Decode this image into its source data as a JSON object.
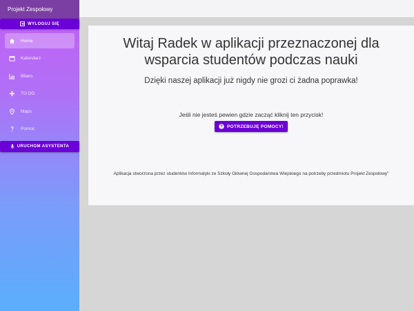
{
  "app": {
    "title": "Projekt Zespołowy"
  },
  "sidebar": {
    "logout_label": "WYLOGUJ SIĘ",
    "items": [
      {
        "label": "Home",
        "icon": "home-icon",
        "active": true
      },
      {
        "label": "Kalendarz",
        "icon": "calendar-icon",
        "active": false
      },
      {
        "label": "Bilans",
        "icon": "chart-icon",
        "active": false
      },
      {
        "label": "TO DO",
        "icon": "plus-icon",
        "active": false
      },
      {
        "label": "Maps",
        "icon": "map-pin-icon",
        "active": false
      },
      {
        "label": "Pomoc",
        "icon": "help-icon",
        "active": false
      }
    ],
    "assistant_label": "URUCHOM ASYSTENTA"
  },
  "main": {
    "welcome": "Witaj Radek w aplikacji przeznaczonej dla wsparcia studentów podczas nauki",
    "subtitle": "Dzięki naszej aplikacji już nigdy nie grozi ci żadna poprawka!",
    "help_text": "Jeśli nie jesteś pewien gdzie zacząć kliknij ten przycisk!",
    "help_button": "POTRZEBUJĘ POMOCY!",
    "footer_note": "Aplikacja stworzona przez studentów Informatyki ze Szkoły Głównej Gospodarstwa Wiejskiego na potrzeby przedmiotu Projekt Zespołowy\""
  },
  "colors": {
    "accent": "#6b00d7",
    "header": "#7b3fa3",
    "gradient_top": "#c35ff3",
    "gradient_bottom": "#5aaefc"
  }
}
